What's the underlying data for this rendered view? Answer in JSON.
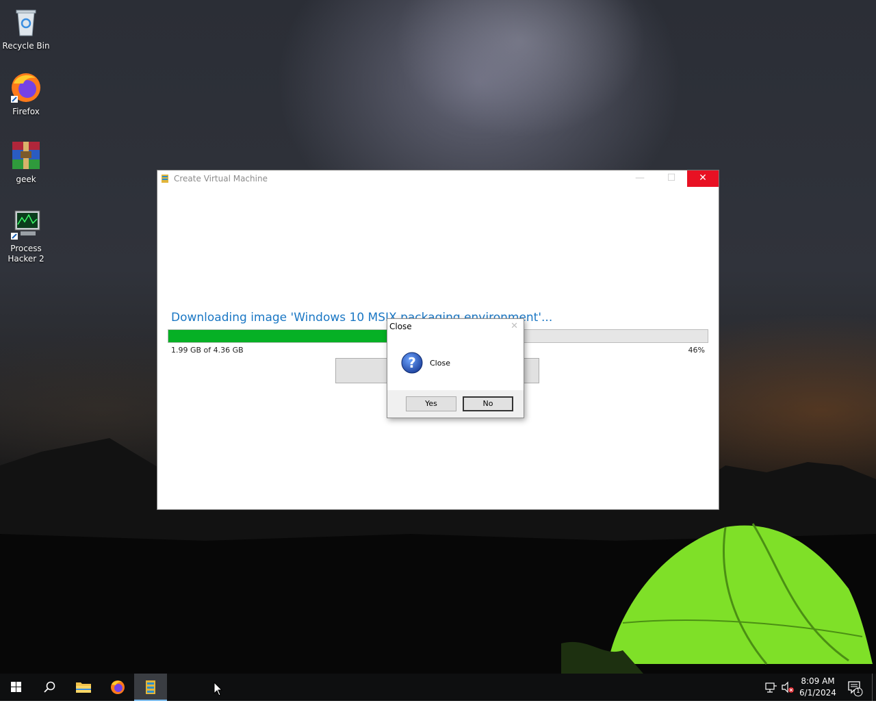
{
  "desktop": {
    "icons": [
      {
        "label": "Recycle Bin",
        "icon": "recycle-bin-icon"
      },
      {
        "label": "Firefox",
        "icon": "firefox-icon"
      },
      {
        "label": "geek",
        "icon": "winrar-icon"
      },
      {
        "label": "Process Hacker 2",
        "icon": "process-hacker-icon"
      }
    ]
  },
  "main_window": {
    "title": "Create Virtual Machine",
    "minimize_glyph": "—",
    "maximize_glyph": "☐",
    "close_glyph": "✕",
    "download_text": "Downloading image 'Windows 10 MSIX packaging environment'...",
    "progress_percent": 46,
    "progress_fraction": 0.46,
    "size_text": "1.99 GB of 4.36 GB",
    "percent_text": "46%",
    "progress_color": "#06b025"
  },
  "dialog": {
    "title": "Close",
    "close_glyph": "✕",
    "message": "Close",
    "icon": "question-icon",
    "yes_label": "Yes",
    "no_label": "No"
  },
  "taskbar": {
    "items": [
      {
        "name": "start",
        "icon": "windows-logo-icon"
      },
      {
        "name": "search",
        "icon": "search-icon"
      },
      {
        "name": "file-explorer",
        "icon": "folder-icon"
      },
      {
        "name": "firefox",
        "icon": "firefox-icon"
      },
      {
        "name": "create-vm",
        "icon": "hyperv-icon",
        "active": true
      }
    ],
    "clock_time": "8:09 AM",
    "clock_date": "6/1/2024",
    "notification_count": "1"
  }
}
